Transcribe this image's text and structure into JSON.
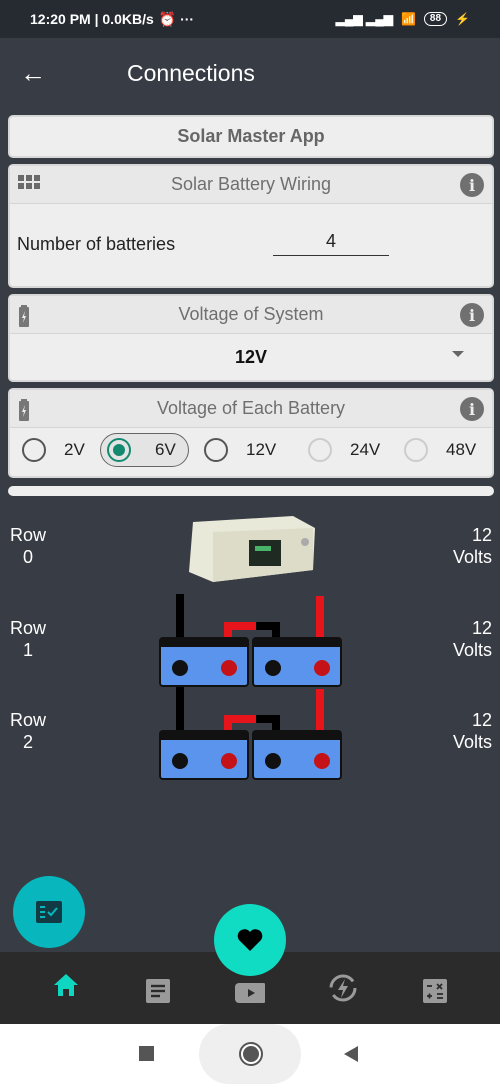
{
  "status_bar": {
    "time": "12:20 PM | 0.0KB/s",
    "battery": "88"
  },
  "app_bar": {
    "title": "Connections"
  },
  "solar_master_button": "Solar Master App",
  "wiring": {
    "title": "Solar Battery Wiring",
    "label": "Number of batteries",
    "value": "4"
  },
  "system_voltage": {
    "title": "Voltage of System",
    "selected": "12V"
  },
  "battery_voltage": {
    "title": "Voltage of Each Battery",
    "options": [
      {
        "label": "2V",
        "state": "unchecked"
      },
      {
        "label": "6V",
        "state": "checked"
      },
      {
        "label": "12V",
        "state": "unchecked"
      },
      {
        "label": "24V",
        "state": "disabled"
      },
      {
        "label": "48V",
        "state": "disabled"
      }
    ]
  },
  "rows": [
    {
      "label": "Row",
      "index": "0",
      "volts": "12",
      "unit": "Volts"
    },
    {
      "label": "Row",
      "index": "1",
      "volts": "12",
      "unit": "Volts"
    },
    {
      "label": "Row",
      "index": "2",
      "volts": "12",
      "unit": "Volts"
    }
  ],
  "colors": {
    "accent": "#0fd6c1",
    "radio_checked": "#138a6f",
    "battery_blue": "#5b94ec"
  },
  "bottom_nav": [
    "home",
    "articles",
    "videos",
    "energy",
    "calculator"
  ]
}
